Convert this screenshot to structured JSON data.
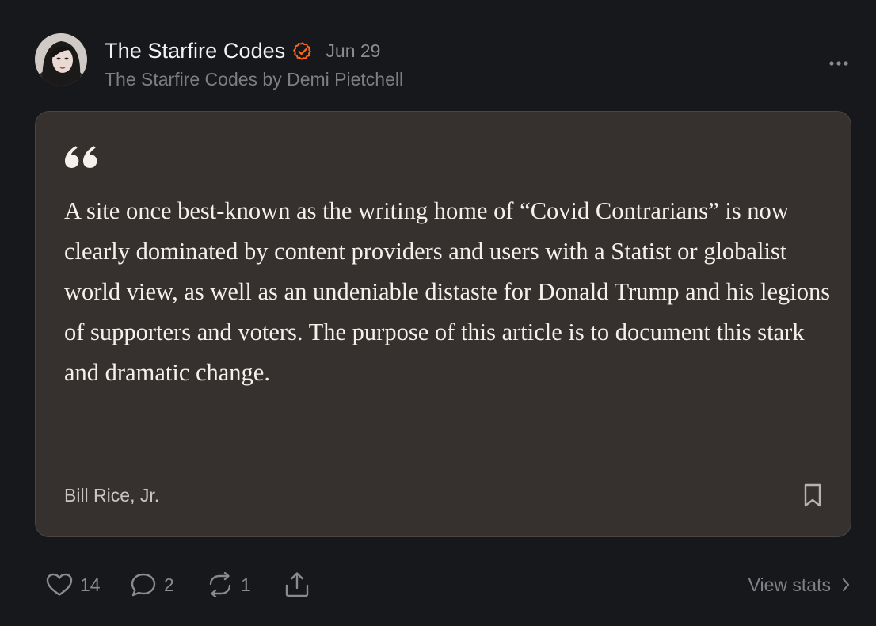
{
  "header": {
    "author_name": "The Starfire Codes",
    "date": "Jun 29",
    "publication": "The Starfire Codes by Demi Pietchell",
    "avatar_icon": "avatar-photo",
    "verified_icon": "verified-badge-icon",
    "more_icon": "ellipsis-icon"
  },
  "quote": {
    "text": "A site once best-known as the writing home of “Covid Contrarians” is now clearly dominated by content providers and users with a Statist or globalist world view, as well as an undeniable distaste for Donald Trump and his legions of supporters and voters. The purpose of this article is to document this stark and dramatic change.",
    "author": "Bill Rice, Jr.",
    "quote_icon": "quote-mark-icon",
    "bookmark_icon": "bookmark-icon"
  },
  "actions": {
    "likes": "14",
    "comments": "2",
    "restacks": "1",
    "view_stats": "View stats"
  },
  "colors": {
    "background": "#17181b",
    "card": "#36312e",
    "accent": "#ff6719",
    "muted_text": "#8a8b8f"
  }
}
